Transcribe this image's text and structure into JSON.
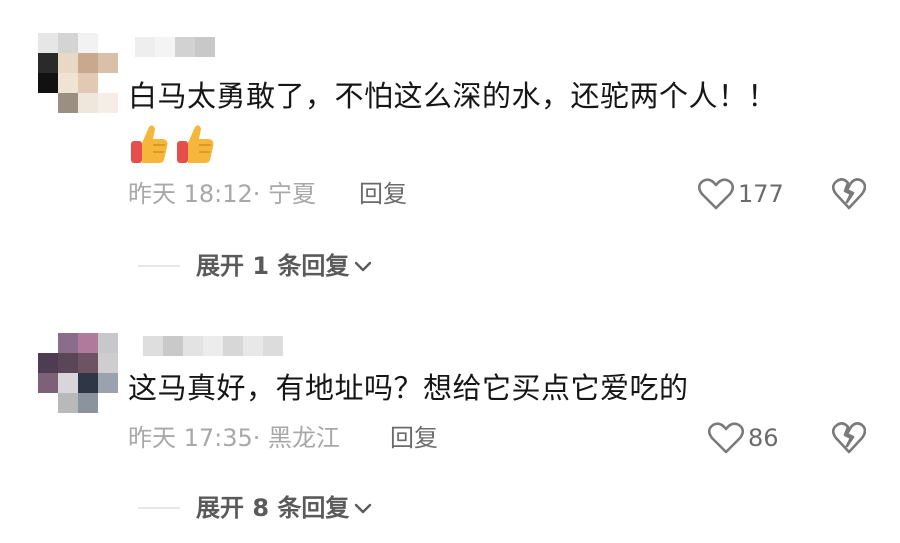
{
  "comments": [
    {
      "text": "白马太勇敢了，不怕这么深的水，还驼两个人！！",
      "emoji": [
        "thumbs-up-icon",
        "thumbs-up-icon"
      ],
      "time": "昨天 18:12",
      "location": "· 宁夏",
      "reply_label": "回复",
      "likes": "177",
      "expand_label": "展开 1 条回复",
      "avatar_colors": [
        "#e6e6e6",
        "#d4d4d4",
        "#f2f2f2",
        "#ffffff",
        "#2a2a2a",
        "#e9d8c6",
        "#c9a98d",
        "#d8c0a9",
        "#111111",
        "#f1e3d3",
        "#e2c9b3",
        "#ffffff",
        "#ffffff",
        "#9a8f80",
        "#efe6dc",
        "#f5eee6"
      ],
      "username_colors": [
        "#eeeeee",
        "#f4f4f4",
        "#d2d2d2",
        "#c8c8c8"
      ]
    },
    {
      "text": "这马真好，有地址吗？想给它买点它爱吃的",
      "time": "昨天 17:35",
      "location": "· 黑龙江",
      "reply_label": "回复",
      "likes": "86",
      "expand_label": "展开 8 条回复",
      "avatar_colors": [
        "#ffffff",
        "#8b6c8a",
        "#b07a9c",
        "#c8c8cc",
        "#4d3c52",
        "#5a4656",
        "#6e5363",
        "#d0cdd0",
        "#7c6177",
        "#d8d6da",
        "#2f3645",
        "#9aa3ad",
        "#ffffff",
        "#b9b9b9",
        "#8b949e",
        "#ffffff"
      ],
      "username_colors": [
        "#dedede",
        "#c9c9c9",
        "#e3e3e3",
        "#ececec",
        "#d7d7d7",
        "#e8e8e8",
        "#dcdcdc"
      ]
    }
  ],
  "colors": {
    "text_primary": "#161616",
    "text_meta": "#a8a8a8",
    "text_secondary": "#6b6b6b",
    "divider": "#e6e6e6",
    "thumb_yellow": "#f6b63b",
    "thumb_red": "#e84d4d"
  }
}
